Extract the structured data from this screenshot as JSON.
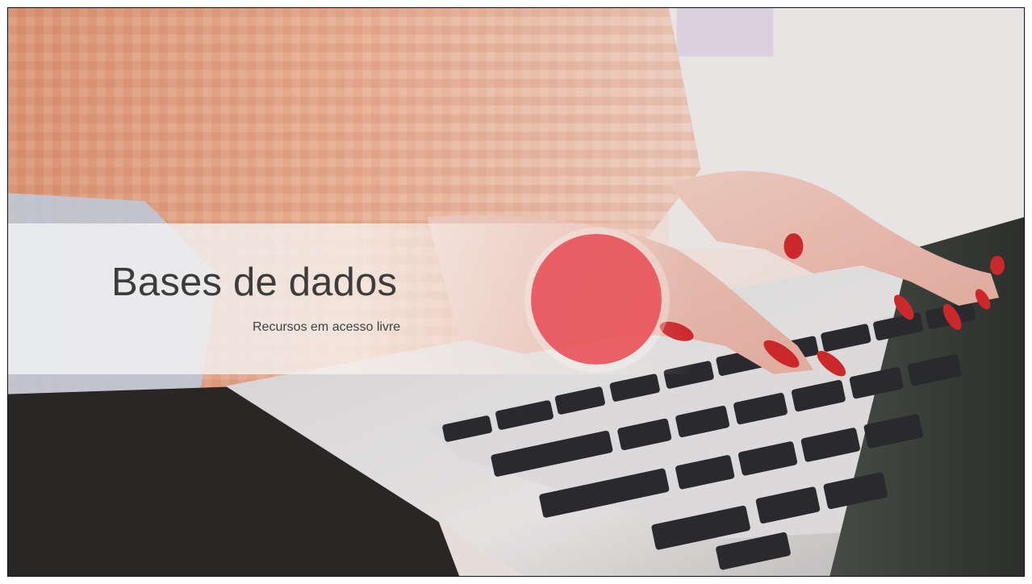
{
  "slide": {
    "title": "Bases de dados",
    "subtitle": "Recursos em acesso livre"
  },
  "colors": {
    "accent": "#e8545a",
    "title_text": "#3c3c3c",
    "band": "#eef0f4"
  },
  "background_image": "photo of hands with red nail polish typing on a laptop keyboard"
}
